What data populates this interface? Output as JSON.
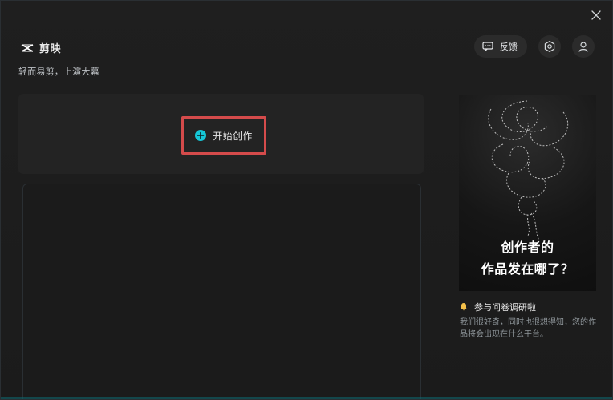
{
  "app": {
    "name": "剪映",
    "tagline": "轻而易剪，上演大幕"
  },
  "header": {
    "feedback_label": "反馈"
  },
  "main": {
    "create_label": "开始创作"
  },
  "promo": {
    "image_line1": "创作者的",
    "image_line2": "作品发在哪了？",
    "survey_title": "参与问卷调研啦",
    "survey_desc": "我们很好奇，同时也很想得知，您的作品将会出现在什么平台。"
  },
  "icons": {
    "close": "close-icon",
    "brand": "capcut-logo-icon",
    "feedback": "feedback-icon",
    "settings": "settings-icon",
    "user": "user-icon",
    "plus": "plus-circle-icon",
    "bell": "bell-icon"
  },
  "colors": {
    "accent_cyan": "#16c6d6",
    "highlight_red": "#d44b4b",
    "bell_yellow": "#f3c04a"
  }
}
